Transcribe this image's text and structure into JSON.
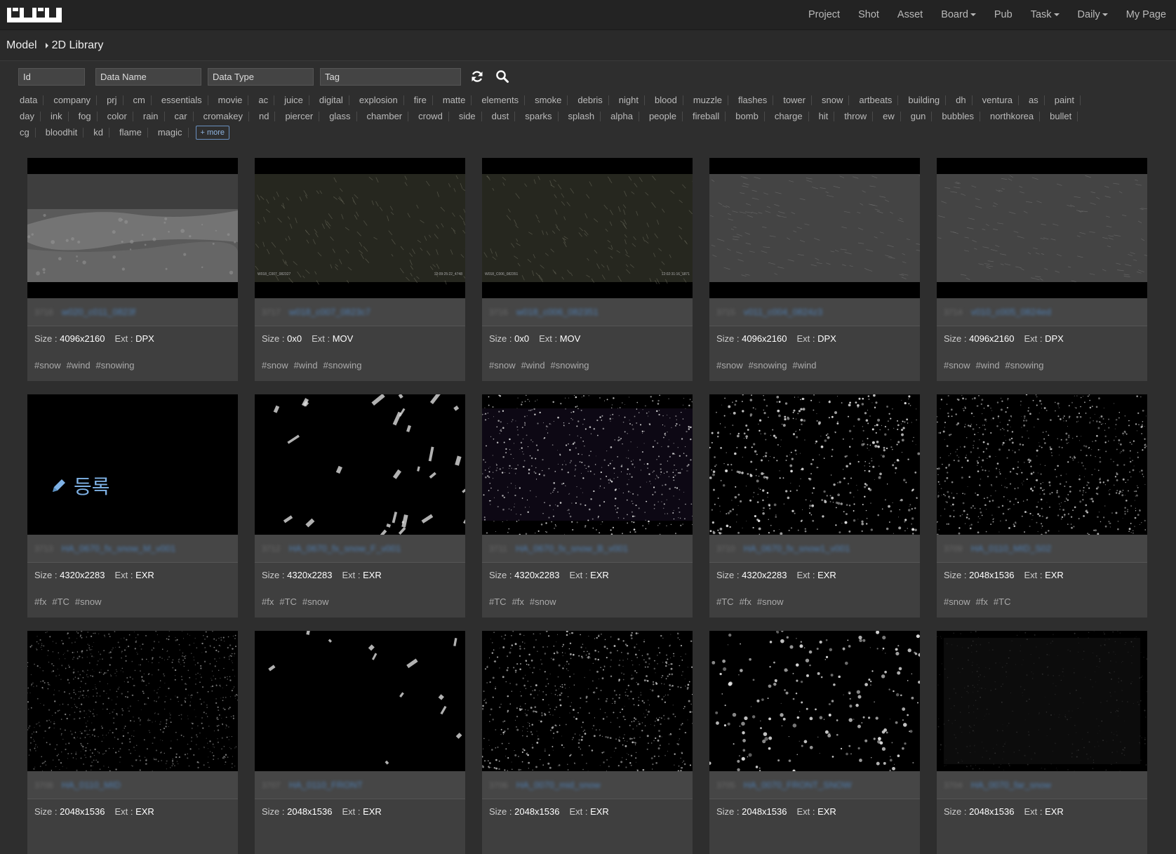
{
  "nav": {
    "items": [
      {
        "label": "Project",
        "dropdown": false
      },
      {
        "label": "Shot",
        "dropdown": false
      },
      {
        "label": "Asset",
        "dropdown": false
      },
      {
        "label": "Board",
        "dropdown": true
      },
      {
        "label": "Pub",
        "dropdown": false
      },
      {
        "label": "Task",
        "dropdown": true
      },
      {
        "label": "Daily",
        "dropdown": true
      },
      {
        "label": "My Page",
        "dropdown": false
      }
    ]
  },
  "breadcrumb": {
    "root": "Model",
    "current": "2D Library"
  },
  "filters": {
    "id_placeholder": "Id",
    "name_placeholder": "Data Name",
    "type_placeholder": "Data Type",
    "tag_placeholder": "Tag"
  },
  "tag_rows": [
    [
      "data",
      "company",
      "prj",
      "cm",
      "essentials",
      "movie",
      "ac",
      "juice",
      "digital",
      "explosion",
      "fire",
      "matte",
      "elements",
      "smoke",
      "debris",
      "night",
      "blood",
      "muzzle",
      "flashes",
      "tower",
      "snow",
      "artbeats",
      "building",
      "dh",
      "ventura",
      "as",
      "paint"
    ],
    [
      "day",
      "ink",
      "fog",
      "color",
      "rain",
      "car",
      "cromakey",
      "nd",
      "piercer",
      "glass",
      "chamber",
      "crowd",
      "side",
      "dust",
      "sparks",
      "splash",
      "alpha",
      "people",
      "fireball",
      "bomb",
      "charge",
      "hit",
      "throw",
      "ew",
      "gun",
      "bubbles",
      "northkorea",
      "bullet"
    ],
    [
      "cg",
      "bloodhit",
      "kd",
      "flame",
      "magic"
    ]
  ],
  "more_label": "+ more",
  "size_label": "Size : ",
  "ext_label": "Ext : ",
  "register_label": "등록",
  "colors": {
    "accent": "#4f7fb3",
    "register": "#7fb2e6"
  },
  "cards": [
    {
      "id": "3718",
      "name": "w020_c011_0823f",
      "size": "4096x2160",
      "ext": "DPX",
      "tags": [
        "#snow",
        "#wind",
        "#snowing"
      ],
      "thumb": "ocean"
    },
    {
      "id": "3717",
      "name": "w018_c007_0823c7",
      "size": "0x0",
      "ext": "MOV",
      "tags": [
        "#snow",
        "#wind",
        "#snowing"
      ],
      "thumb": "dark-rain",
      "overlay_left": "W018_C007_082327",
      "overlay_right": "12:09:25:22_4748"
    },
    {
      "id": "3716",
      "name": "w018_c006_082351",
      "size": "0x0",
      "ext": "MOV",
      "tags": [
        "#snow",
        "#wind",
        "#snowing"
      ],
      "thumb": "dark-rain",
      "overlay_left": "W018_C006_082351",
      "overlay_right": "12:02:31:16_1871"
    },
    {
      "id": "3715",
      "name": "v011_c004_0824z3",
      "size": "4096x2160",
      "ext": "DPX",
      "tags": [
        "#snow",
        "#snowing",
        "#wind"
      ],
      "thumb": "grey"
    },
    {
      "id": "3714",
      "name": "v010_c005_0824ed",
      "size": "4096x2160",
      "ext": "DPX",
      "tags": [
        "#snow",
        "#wind",
        "#snowing"
      ],
      "thumb": "grey"
    },
    {
      "id": "3713",
      "name": "HA_0670_fx_snow_M_v001",
      "size": "4320x2283",
      "ext": "EXR",
      "tags": [
        "#fx",
        "#TC",
        "#snow"
      ],
      "thumb": "register"
    },
    {
      "id": "3712",
      "name": "HA_0670_fx_snow_F_v001",
      "size": "4320x2283",
      "ext": "EXR",
      "tags": [
        "#fx",
        "#TC",
        "#snow"
      ],
      "thumb": "flakes-big"
    },
    {
      "id": "3711",
      "name": "HA_0670_fx_snow_B_v001",
      "size": "4320x2283",
      "ext": "EXR",
      "tags": [
        "#TC",
        "#fx",
        "#snow"
      ],
      "thumb": "flakes-small"
    },
    {
      "id": "3710",
      "name": "HA_0670_fx_snow1_v001",
      "size": "4320x2283",
      "ext": "EXR",
      "tags": [
        "#TC",
        "#fx",
        "#snow"
      ],
      "thumb": "flakes-mid"
    },
    {
      "id": "3709",
      "name": "HA_0110_MID_S02",
      "size": "2048x1536",
      "ext": "EXR",
      "tags": [
        "#snow",
        "#fx",
        "#TC"
      ],
      "thumb": "flakes-dense"
    },
    {
      "id": "3708",
      "name": "HA_0110_MID",
      "size": "2048x1536",
      "ext": "EXR",
      "tags": [],
      "thumb": "flakes-grain"
    },
    {
      "id": "3707",
      "name": "HA_0110_FRONT",
      "size": "2048x1536",
      "ext": "EXR",
      "tags": [],
      "thumb": "flakes-streak"
    },
    {
      "id": "3706",
      "name": "HA_0070_mid_snow",
      "size": "2048x1536",
      "ext": "EXR",
      "tags": [],
      "thumb": "flakes-dense"
    },
    {
      "id": "3705",
      "name": "HA_0070_FRONT_SNOW",
      "size": "2048x1536",
      "ext": "EXR",
      "tags": [],
      "thumb": "flakes-big2"
    },
    {
      "id": "3704",
      "name": "HA_0070_far_snow",
      "size": "2048x1536",
      "ext": "EXR",
      "tags": [],
      "thumb": "faint"
    }
  ]
}
